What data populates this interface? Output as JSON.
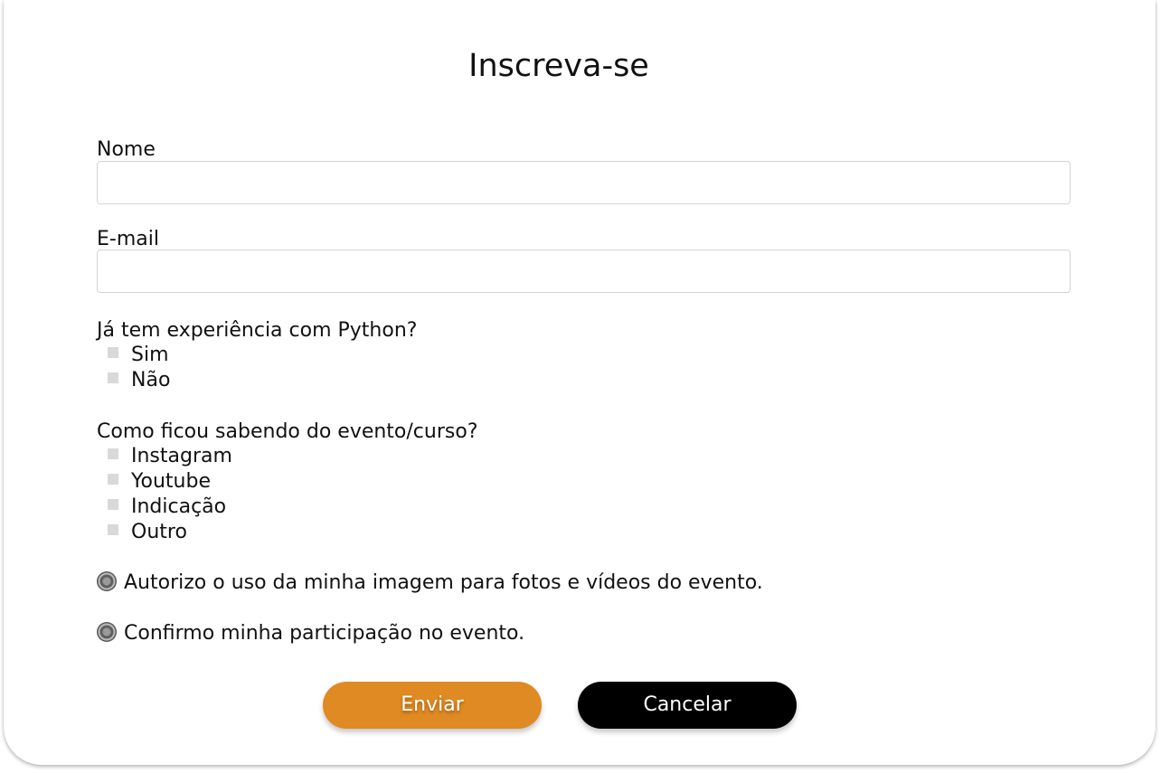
{
  "form": {
    "title": "Inscreva-se",
    "name_label": "Nome",
    "name_value": "",
    "email_label": "E-mail",
    "email_value": "",
    "python_question": "Já tem experiência com Python?",
    "python_options": [
      "Sim",
      "Não"
    ],
    "source_question": "Como ficou sabendo do evento/curso?",
    "source_options": [
      "Instagram",
      "Youtube",
      "Indicação",
      "Outro"
    ],
    "image_consent": "Autorizo o uso da minha imagem para fotos e vídeos do evento.",
    "participation_confirm": "Confirmo minha participação no evento.",
    "submit_label": "Enviar",
    "cancel_label": "Cancelar"
  },
  "colors": {
    "submit_button": "#df8a22",
    "cancel_button": "#000000",
    "checkbox": "#d9d9d9",
    "input_border": "#d4d4d4"
  }
}
